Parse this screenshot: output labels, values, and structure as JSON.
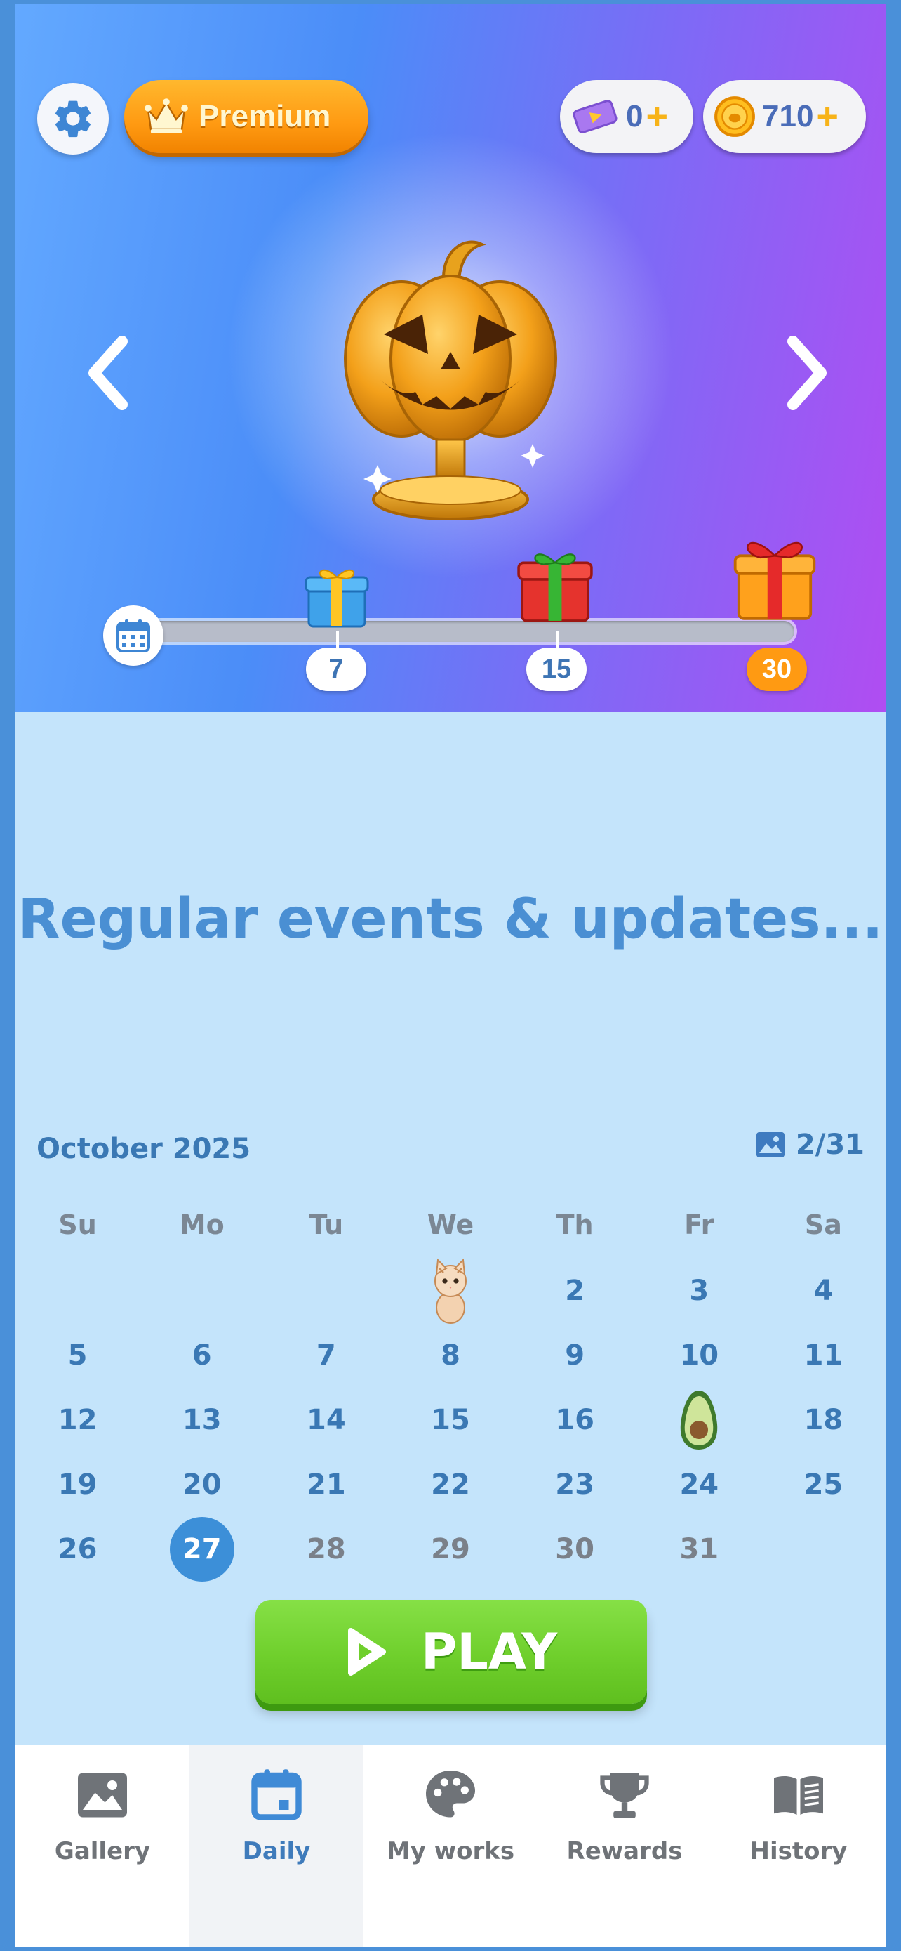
{
  "header": {
    "premium_label": "Premium",
    "tickets": "0",
    "coins": "710"
  },
  "event": {
    "progress": 0.02,
    "milestones": [
      "7",
      "15",
      "30"
    ]
  },
  "headline": "Regular events & updates...",
  "calendar": {
    "month": "October 2025",
    "completed_count": "2/31",
    "weekdays": [
      "Su",
      "Mo",
      "Tu",
      "We",
      "Th",
      "Fr",
      "Sa"
    ],
    "weeks": [
      [
        "",
        "",
        "",
        "",
        "2",
        "3",
        "4"
      ],
      [
        "5",
        "6",
        "7",
        "8",
        "9",
        "10",
        "11"
      ],
      [
        "12",
        "13",
        "14",
        "15",
        "16",
        "",
        "18"
      ],
      [
        "19",
        "20",
        "21",
        "22",
        "23",
        "24",
        "25"
      ],
      [
        "26",
        "27",
        "28",
        "29",
        "30",
        "31",
        ""
      ]
    ],
    "today": "27"
  },
  "play_label": "PLAY",
  "nav": {
    "gallery": "Gallery",
    "daily": "Daily",
    "my_works": "My works",
    "rewards": "Rewards",
    "history": "History"
  },
  "colors": {
    "accent": "#3c8fd8",
    "play_green": "#6fcf2c",
    "premium_orange": "#ff9a12"
  }
}
